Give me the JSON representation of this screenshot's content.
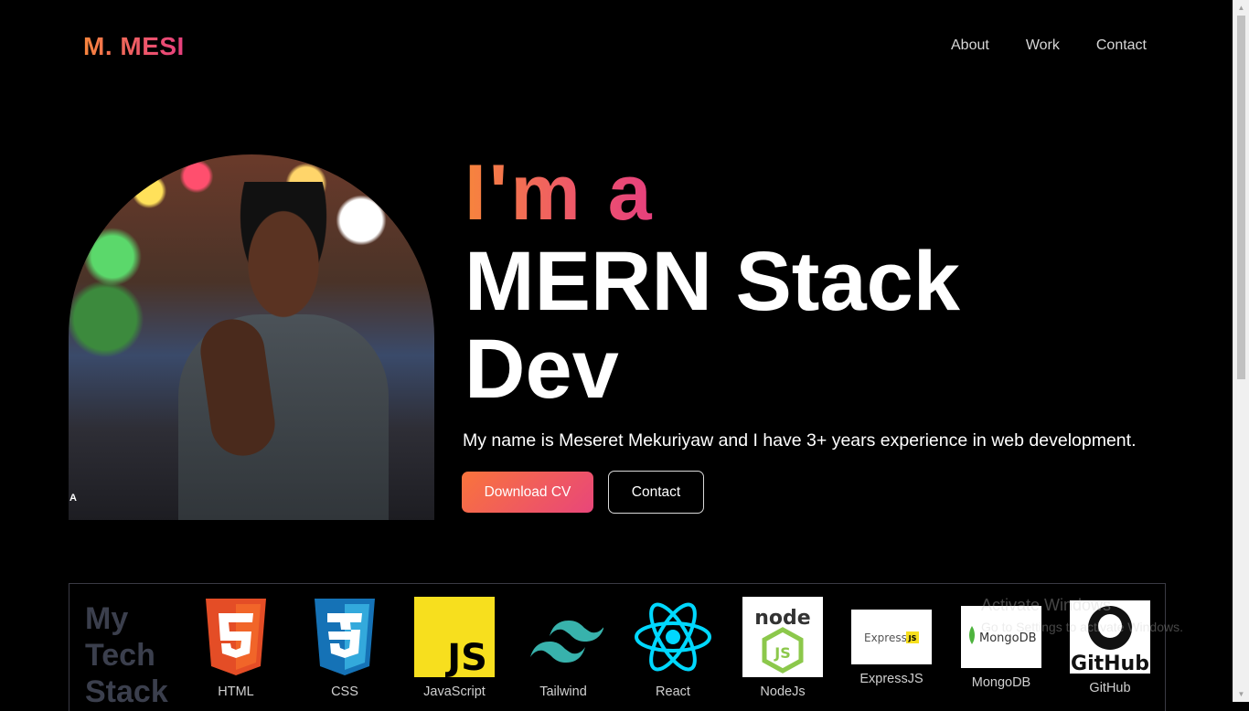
{
  "header": {
    "logo": "M. MESI",
    "nav": [
      "About",
      "Work",
      "Contact"
    ]
  },
  "hero": {
    "photo_alt_fragment": "A",
    "line1": "I'm a",
    "line2": "MERN Stack",
    "line3": "Dev",
    "description": "My name is Meseret Mekuriyaw and I have 3+ years experience in web development.",
    "download_label": "Download CV",
    "contact_label": "Contact"
  },
  "stack": {
    "title_lines": [
      "My",
      "Tech",
      "Stack"
    ],
    "items": [
      {
        "label": "HTML",
        "icon": "html5-icon"
      },
      {
        "label": "CSS",
        "icon": "css3-icon"
      },
      {
        "label": "JavaScript",
        "icon": "javascript-icon"
      },
      {
        "label": "Tailwind",
        "icon": "tailwind-icon"
      },
      {
        "label": "React",
        "icon": "react-icon"
      },
      {
        "label": "NodeJs",
        "icon": "nodejs-icon"
      },
      {
        "label": "ExpressJS",
        "icon": "expressjs-icon"
      },
      {
        "label": "MongoDB",
        "icon": "mongodb-icon"
      },
      {
        "label": "GitHub",
        "icon": "github-icon"
      }
    ],
    "logo_text": {
      "js": "JS",
      "node": "node",
      "express": "Express",
      "express_js": "JS",
      "mongodb": "MongoDB",
      "github": "GitHub"
    }
  },
  "watermark": {
    "line1": "Activate Windows",
    "line2": "Go to Settings to activate Windows."
  },
  "colors": {
    "accent_start": "#f7853c",
    "accent_end": "#e63f7e",
    "background": "#000000"
  }
}
